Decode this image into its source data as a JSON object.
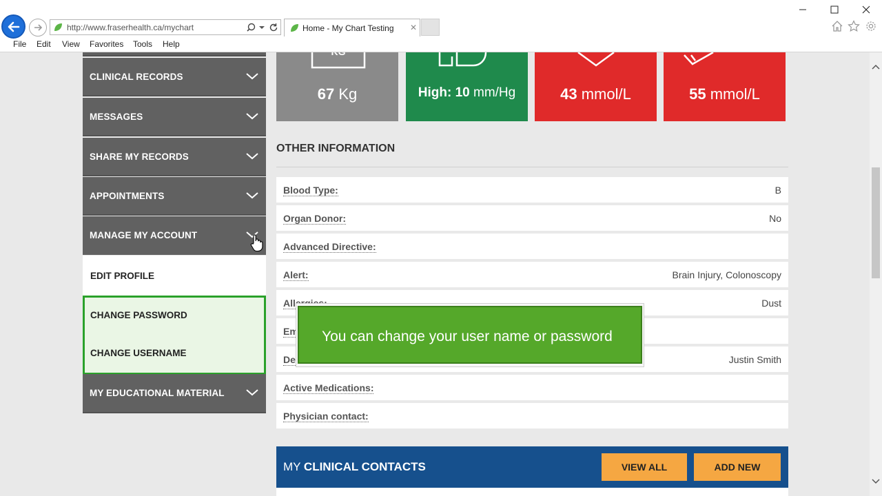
{
  "browser": {
    "url": "http://www.fraserhealth.ca/mychart",
    "tab_title": "Home - My Chart Testing",
    "tab_close": "✕",
    "menu": [
      "File",
      "Edit",
      "View",
      "Favorites",
      "Tools",
      "Help"
    ]
  },
  "sidebar": {
    "items": [
      {
        "label": "CLINICAL RECORDS"
      },
      {
        "label": "MESSAGES"
      },
      {
        "label": "SHARE MY RECORDS"
      },
      {
        "label": "APPOINTMENTS"
      },
      {
        "label": "MANAGE MY ACCOUNT"
      },
      {
        "label": "MY EDUCATIONAL MATERIAL"
      }
    ],
    "sub_items": [
      "EDIT PROFILE",
      "CHANGE PASSWORD",
      "CHANGE USERNAME"
    ]
  },
  "tiles": [
    {
      "value": "67",
      "unit": "Kg",
      "prefix": "",
      "color": "#8a8a8a"
    },
    {
      "value": "10",
      "unit": "mm/Hg",
      "prefix": "High: ",
      "color": "#1f8a4c"
    },
    {
      "value": "43",
      "unit": "mmol/L",
      "prefix": "",
      "color": "#e02a2a"
    },
    {
      "value": "55",
      "unit": "mmol/L",
      "prefix": "",
      "color": "#e02a2a"
    }
  ],
  "tile_icon_text": "KG",
  "other_info": {
    "title": "OTHER INFORMATION",
    "rows": [
      {
        "label": "Blood Type:",
        "value": "B"
      },
      {
        "label": "Organ Donor:",
        "value": "No"
      },
      {
        "label": "Advanced Directive:",
        "value": ""
      },
      {
        "label": "Alert:",
        "value": "Brain Injury, Colonoscopy"
      },
      {
        "label": "Allergies:",
        "value": "Dust"
      },
      {
        "label": "Em",
        "value": ""
      },
      {
        "label": "De",
        "value": "Justin Smith"
      },
      {
        "label": "Active Medications:",
        "value": ""
      },
      {
        "label": "Physician contact:",
        "value": ""
      }
    ]
  },
  "tooltip": {
    "text": "You can change your user name or password"
  },
  "contacts": {
    "title_prefix": "MY ",
    "title_bold": "CLINICAL CONTACTS",
    "view_all": "VIEW ALL",
    "add_new": "ADD NEW"
  },
  "colors": {
    "sidebar_bg": "#616161",
    "highlight_border": "#2aa12a",
    "tooltip_green": "#55a82a",
    "contacts_blue": "#16508d",
    "button_orange": "#f5a742"
  }
}
